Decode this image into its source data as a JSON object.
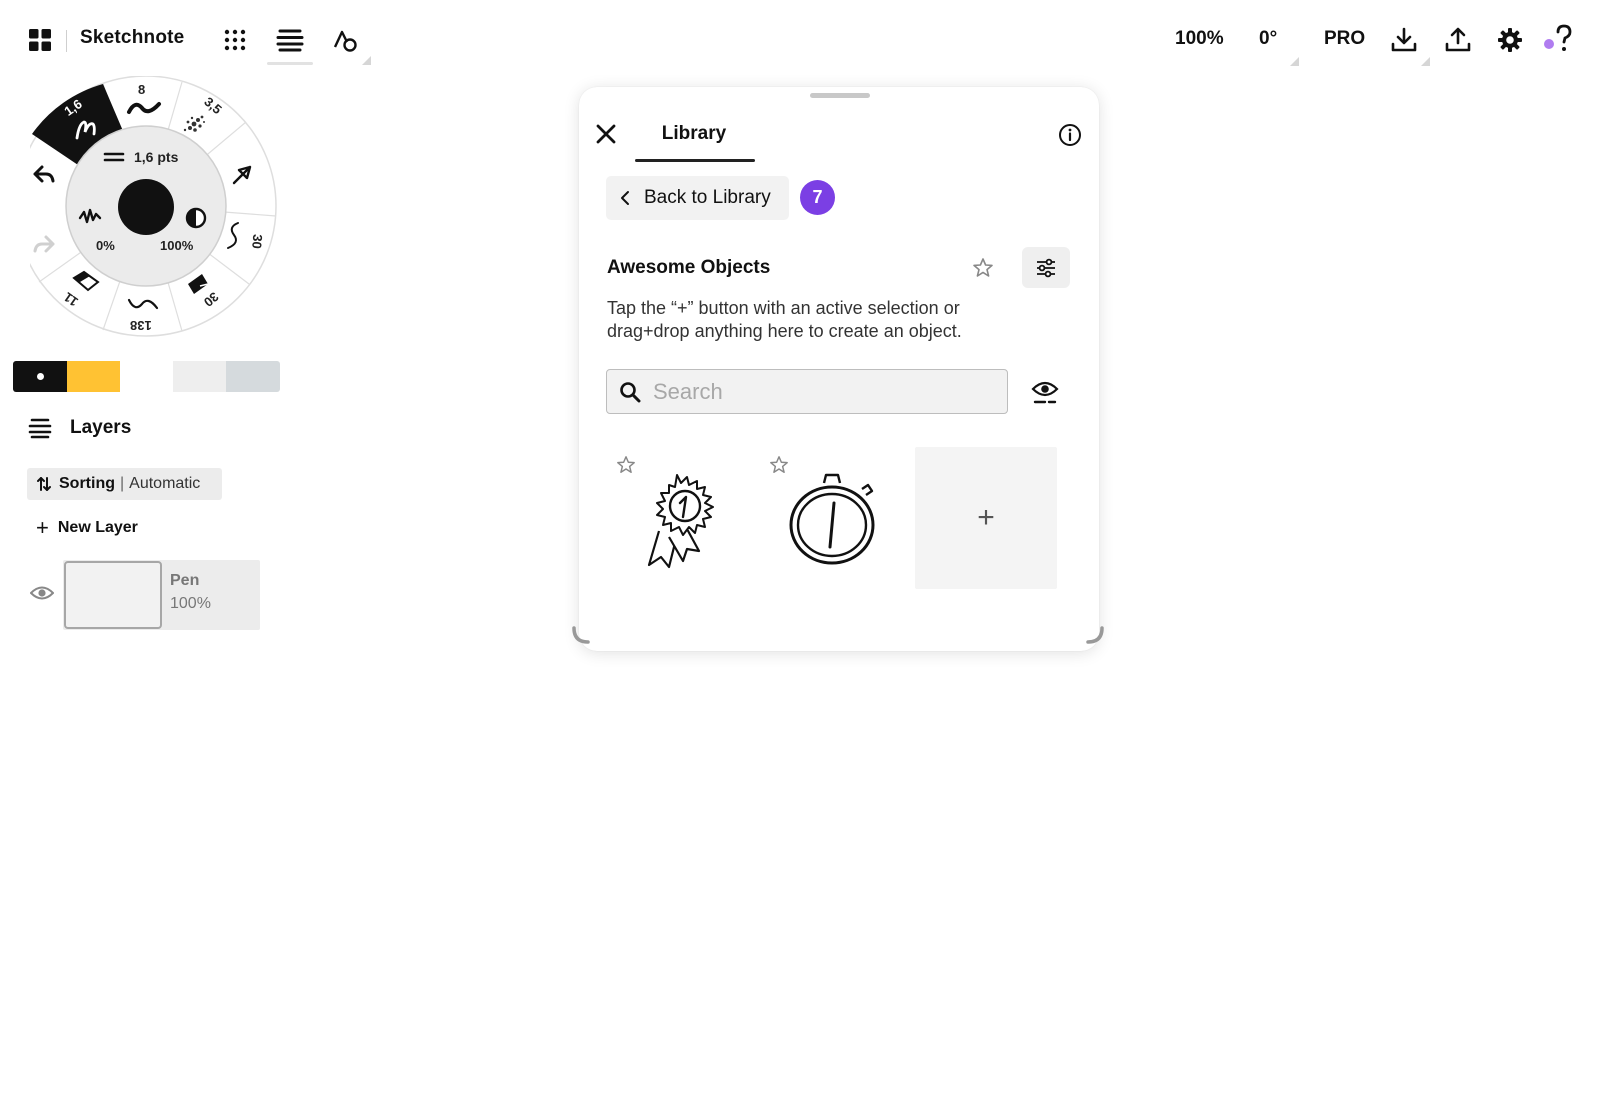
{
  "app": {
    "title": "Sketchnote"
  },
  "topbar": {
    "zoom": "100%",
    "rotation": "0°",
    "pro_label": "PRO"
  },
  "brush_wheel": {
    "active_size": "1,6",
    "size_8": "8",
    "size_3_5": "3,5",
    "size_30_right": "30",
    "size_30_bottom": "30",
    "size_138": "138",
    "size_11": "11",
    "stroke_pts": "1,6 pts",
    "opacity_min": "0%",
    "opacity_max": "100%"
  },
  "colors": {
    "black": "#111111",
    "yellow": "#ffc233",
    "light_gray": "#eeeeee",
    "gray": "#d5dadd",
    "accent": "#7b3fe4"
  },
  "layers": {
    "title": "Layers",
    "sorting_label": "Sorting",
    "sorting_value": "Automatic",
    "new_layer_label": "New Layer",
    "items": [
      {
        "name": "Pen",
        "opacity": "100%"
      }
    ]
  },
  "library": {
    "tab_label": "Library",
    "back_label": "Back to Library",
    "badge_count": "7",
    "collection_title": "Awesome Objects",
    "description": "Tap the “+” button with an active selection or drag+drop anything here to create an object.",
    "search_placeholder": "Search",
    "search_value": "",
    "add_label": "+",
    "objects": [
      {
        "icon": "award-ribbon-icon"
      },
      {
        "icon": "stopwatch-icon"
      }
    ]
  }
}
